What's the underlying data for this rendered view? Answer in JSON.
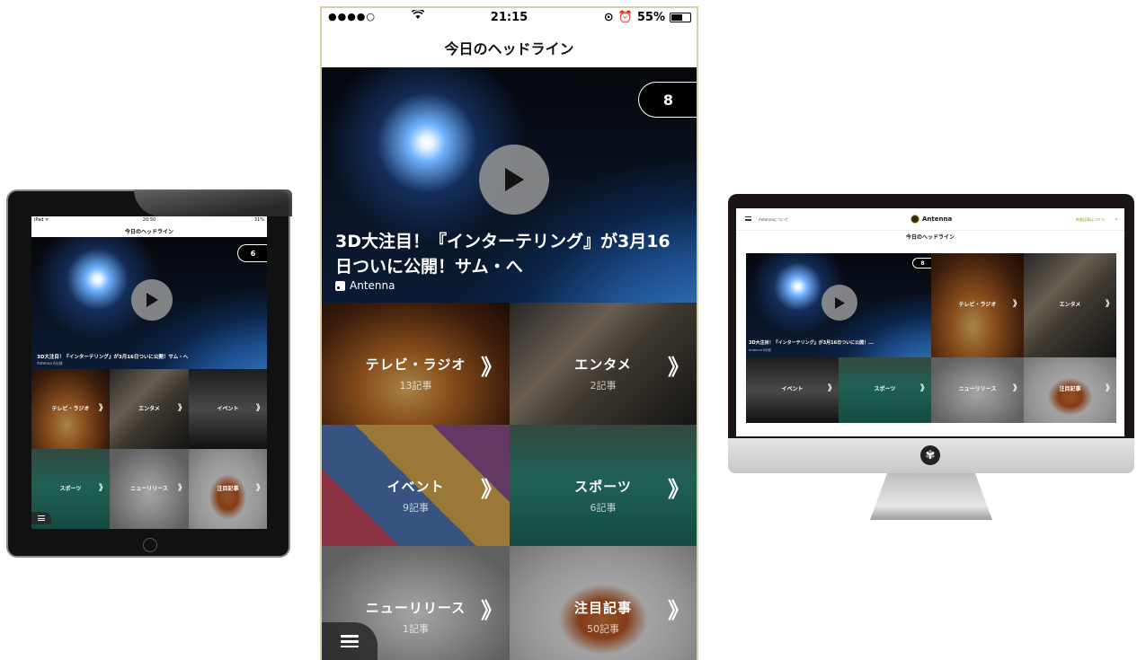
{
  "phone": {
    "status": {
      "signal": "●●●●○",
      "time": "21:15",
      "battery": "55%"
    },
    "nav_title": "今日のヘッドライン",
    "hero": {
      "badge_count": "8",
      "title": "3D大注目！『インターテリング』が3月16日ついに公開！サム・へ",
      "source": "Antenna"
    },
    "categories": [
      {
        "label": "テレビ・ラジオ",
        "count": "13記事"
      },
      {
        "label": "エンタメ",
        "count": "2記事"
      },
      {
        "label": "イベント",
        "count": "9記事"
      },
      {
        "label": "スポーツ",
        "count": "6記事"
      },
      {
        "label": "ニューリリース",
        "count": "1記事"
      },
      {
        "label": "注目記事",
        "count": "50記事"
      }
    ],
    "chevron": "》"
  },
  "tablet": {
    "status": {
      "left": "iPad ᯤ",
      "time": "20:50",
      "right": "31%"
    },
    "nav_title": "今日のヘッドライン",
    "hero": {
      "badge_count": "6",
      "title": "3D大注目！『インターテリング』が3月16日ついに公開！サム・へ",
      "source": "Antenna   6分前"
    },
    "categories": [
      {
        "label": "テレビ・ラジオ",
        "count": ""
      },
      {
        "label": "エンタメ",
        "count": ""
      },
      {
        "label": "イベント",
        "count": ""
      },
      {
        "label": "スポーツ",
        "count": ""
      },
      {
        "label": "ニューリリース",
        "count": ""
      },
      {
        "label": "注目記事",
        "count": ""
      }
    ],
    "chevron": "》"
  },
  "desktop": {
    "about": "Antennaについて",
    "brand": "Antenna",
    "new_link": "新着記事はコチラ",
    "heading": "今日のヘッドライン",
    "hero": {
      "badge_count": "8",
      "title": "3D大注目！『インターテリング』が3月16日ついに公開！...",
      "source": "Antenna   6分前"
    },
    "categories": [
      {
        "label": "テレビ・ラジオ",
        "count": ""
      },
      {
        "label": "エンタメ",
        "count": ""
      },
      {
        "label": "イベント",
        "count": ""
      },
      {
        "label": "スポーツ",
        "count": ""
      },
      {
        "label": "ニューリリース",
        "count": ""
      },
      {
        "label": "注目記事",
        "count": ""
      }
    ],
    "chevron": "》"
  },
  "icons": {
    "play": "play-icon",
    "menu": "hamburger-menu-icon",
    "rss": "rss-icon",
    "wifi": "wifi-icon",
    "battery": "battery-icon",
    "search": "search-icon",
    "apple_logo": "flower-logo-icon"
  },
  "colors": {
    "phone_bezel": "#d9cfa6",
    "badge_bg": "#000000",
    "play_button": "#969696",
    "desktop_new_link": "#8aa626"
  }
}
